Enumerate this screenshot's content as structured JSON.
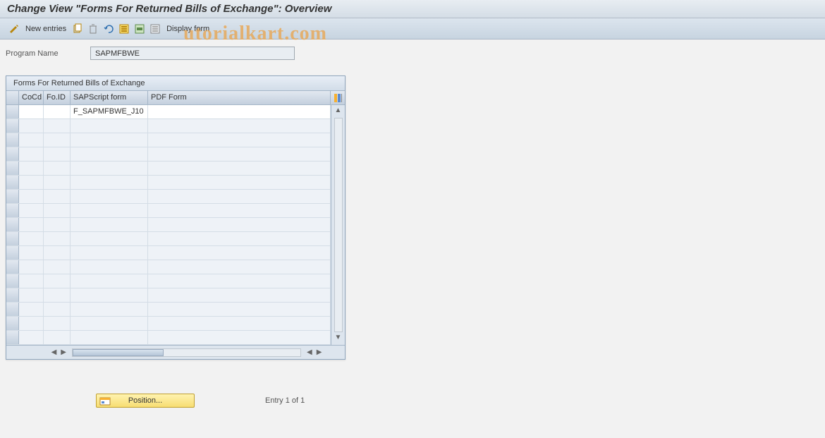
{
  "title": "Change View \"Forms For Returned Bills of Exchange\": Overview",
  "toolbar": {
    "new_entries": "New entries",
    "display_form": "Display form"
  },
  "program": {
    "label": "Program Name",
    "value": "SAPMFBWE"
  },
  "table": {
    "title": "Forms For Returned Bills of Exchange",
    "columns": {
      "cocd": "CoCd",
      "foid": "Fo.ID",
      "sapscript": "SAPScript form",
      "pdf": "PDF Form"
    },
    "rows": [
      {
        "cocd": "",
        "foid": "",
        "sapscript": "F_SAPMFBWE_J10",
        "pdf": ""
      }
    ]
  },
  "footer": {
    "position_btn": "Position...",
    "entry_text": "Entry 1 of 1"
  },
  "watermark_partial_top": "utorialkart.com",
  "watermark_partial_right": "rialkart.com"
}
